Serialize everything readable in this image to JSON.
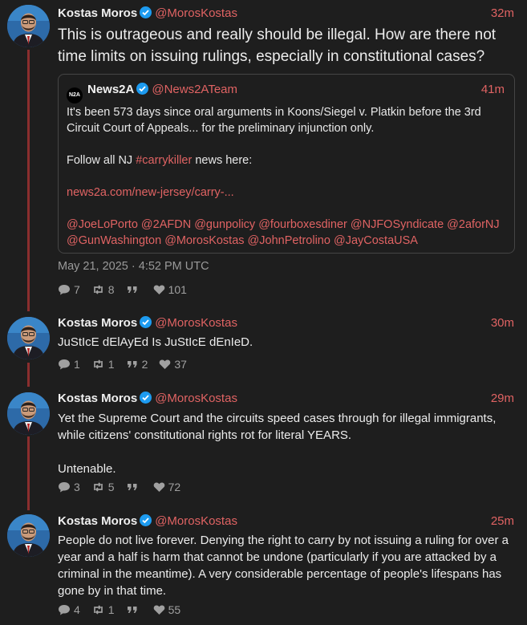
{
  "posts": [
    {
      "name": "Kostas Moros",
      "handle": "@MorosKostas",
      "time": "32m",
      "text": "This is outrageous and really should be illegal. How are there not time limits on issuing rulings, especially in constitutional cases?",
      "quote": {
        "logo": "N2A",
        "name": "News2A",
        "handle": "@News2ATeam",
        "time": "41m",
        "line1": "It's been 573 days since oral arguments in Koons/Siegel v. Platkin before the 3rd Circuit Court of Appeals... for the preliminary injunction only.",
        "line2_prefix": "Follow all NJ ",
        "hashtag": "#carrykiller",
        "line2_suffix": " news here:",
        "url": "news2a.com/new-jersey/carry-...",
        "mentions": "@JoeLoPorto @2AFDN @gunpolicy @fourboxesdiner @NJFOSyndicate @2aforNJ @GunWashington @MorosKostas @JohnPetrolino @JayCostaUSA"
      },
      "date": "May 21, 2025 · 4:52 PM UTC",
      "replies": "7",
      "reposts": "8",
      "quotes": "",
      "likes": "101"
    },
    {
      "name": "Kostas Moros",
      "handle": "@MorosKostas",
      "time": "30m",
      "text": "JuStIcE dElAyEd Is JuStIcE dEnIeD.",
      "replies": "1",
      "reposts": "1",
      "quotes": "2",
      "likes": "37"
    },
    {
      "name": "Kostas Moros",
      "handle": "@MorosKostas",
      "time": "29m",
      "text": "Yet the Supreme Court and the circuits speed cases through for illegal immigrants, while citizens' constitutional rights rot for literal YEARS.\n\nUntenable.",
      "replies": "3",
      "reposts": "5",
      "quotes": "",
      "likes": "72"
    },
    {
      "name": "Kostas Moros",
      "handle": "@MorosKostas",
      "time": "25m",
      "text": "People do not live forever. Denying the right to carry by not issuing a ruling for over a year and a half is harm that cannot be undone (particularly if you are attacked by a criminal in the meantime). A very considerable percentage of people's lifespans has gone by in that time.",
      "replies": "4",
      "reposts": "1",
      "quotes": "",
      "likes": "55"
    }
  ],
  "colors": {
    "accent": "#e06363",
    "thread_line": "#8b2e2e",
    "background": "#1e1e1e",
    "verified": "#1d9bf0"
  },
  "icons": [
    "verified-icon",
    "reply-icon",
    "repost-icon",
    "quote-icon",
    "like-icon"
  ]
}
